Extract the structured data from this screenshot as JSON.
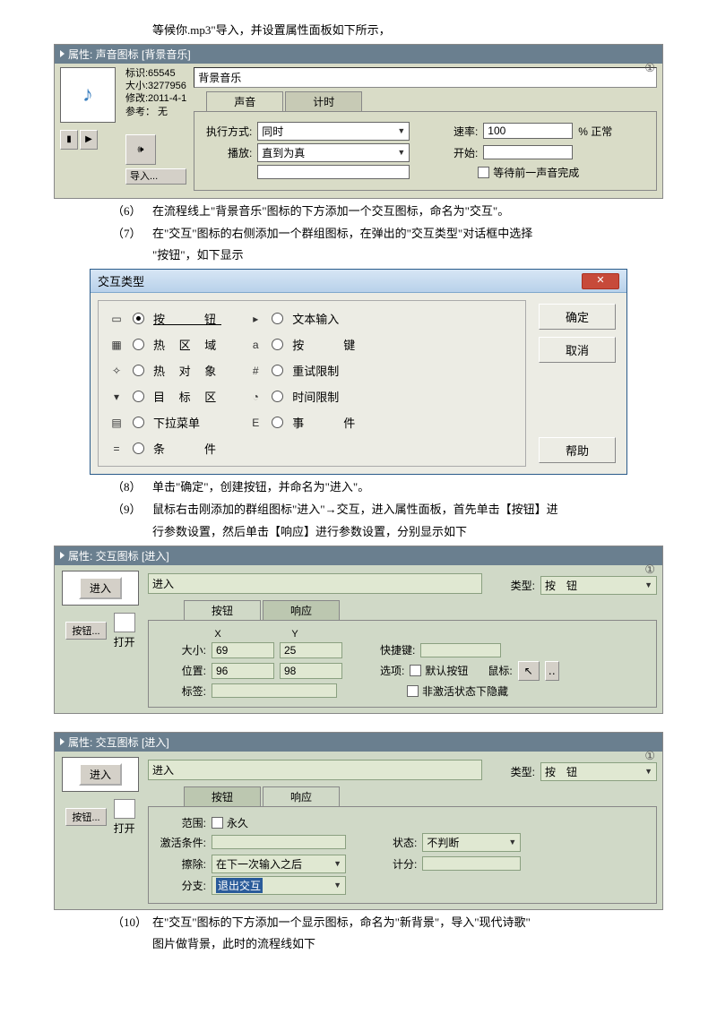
{
  "intro": "等候你.mp3\"导入，并设置属性面板如下所示，",
  "panel1": {
    "title": "属性: 声音图标 [背景音乐]",
    "info": {
      "l1": "标识:65545",
      "l2": "大小:3277956",
      "l3": "修改:2011-4-1",
      "l4": "参考：  无"
    },
    "btns": {
      "play": "▶",
      "stop": "▮",
      "spk": "🔊",
      "import": "导入..."
    },
    "name": "背景音乐",
    "tabs": {
      "a": "声音",
      "b": "计时"
    },
    "exec_lbl": "执行方式:",
    "exec_val": "同时",
    "play_lbl": "播放:",
    "play_val": "直到为真",
    "play_cond": "",
    "rate_lbl": "速率:",
    "rate_val": "100",
    "rate_unit": "% 正常",
    "start_lbl": "开始:",
    "start_val": "",
    "wait_chk": "等待前一声音完成"
  },
  "step6": "在流程线上\"背景音乐\"图标的下方添加一个交互图标，命名为\"交互\"。",
  "step7": "在\"交互\"图标的右侧添加一个群组图标，在弹出的\"交互类型\"对话框中选择",
  "step7b": "\"按钮\"，如下显示",
  "dialog": {
    "title": "交互类型",
    "left": [
      {
        "ico": "▭",
        "lbl": "按　　钮",
        "on": true
      },
      {
        "ico": "▦",
        "lbl": "热 区 域"
      },
      {
        "ico": "✧",
        "lbl": "热 对 象"
      },
      {
        "ico": "▾",
        "lbl": "目 标 区"
      },
      {
        "ico": "▤",
        "lbl": "下拉菜单"
      },
      {
        "ico": "=",
        "lbl": "条　　件"
      }
    ],
    "right": [
      {
        "ico": "▸",
        "lbl": "文本输入"
      },
      {
        "ico": "a",
        "lbl": "按　　键"
      },
      {
        "ico": "#",
        "lbl": "重试限制"
      },
      {
        "ico": "◔",
        "lbl": "时间限制"
      },
      {
        "ico": "E",
        "lbl": "事　　件"
      }
    ],
    "ok": "确定",
    "cancel": "取消",
    "help": "帮助"
  },
  "step8": "单击\"确定\"，创建按钮，并命名为\"进入\"。",
  "step9": "鼠标右击刚添加的群组图标\"进入\"→交互，进入属性面板，首先单击【按钮】进",
  "step9b": "行参数设置，然后单击【响应】进行参数设置，分别显示如下",
  "panel2": {
    "title": "属性: 交互图标 [进入]",
    "prev": "进入",
    "btnset": "按钮...",
    "open": "打开",
    "name": "进入",
    "type_lbl": "类型:",
    "type_val": "按　钮",
    "tabs": {
      "a": "按钮",
      "b": "响应"
    },
    "x": "X",
    "y": "Y",
    "size_lbl": "大小:",
    "sx": "69",
    "sy": "25",
    "pos_lbl": "位置:",
    "px": "96",
    "py": "98",
    "tag_lbl": "标签:",
    "tag": "",
    "short_lbl": "快捷键:",
    "short": "",
    "opt_lbl": "选项:",
    "opt1": "默认按钮",
    "opt2": "非激活状态下隐藏",
    "mouse_lbl": "鼠标:"
  },
  "panel3": {
    "title": "属性: 交互图标 [进入]",
    "prev": "进入",
    "btnset": "按钮...",
    "open": "打开",
    "name": "进入",
    "type_lbl": "类型:",
    "type_val": "按　钮",
    "tabs": {
      "a": "按钮",
      "b": "响应"
    },
    "scope_lbl": "范围:",
    "scope_val": "永久",
    "act_lbl": "激活条件:",
    "act": "",
    "erase_lbl": "擦除:",
    "erase_val": "在下一次输入之后",
    "branch_lbl": "分支:",
    "branch_val": "退出交互",
    "stat_lbl": "状态:",
    "stat_val": "不判断",
    "score_lbl": "计分:",
    "score": ""
  },
  "step10": "在\"交互\"图标的下方添加一个显示图标，命名为\"新背景\"，导入\"现代诗歌\"",
  "step10b": "图片做背景，此时的流程线如下"
}
